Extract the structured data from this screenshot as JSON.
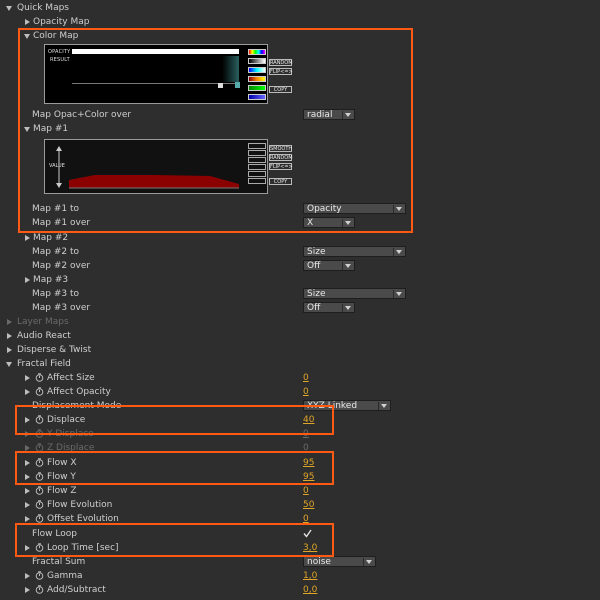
{
  "sections": {
    "quick_maps": "Quick Maps",
    "opacity_map": "Opacity Map",
    "color_map": "Color Map",
    "map1": "Map #1",
    "map2": "Map #2",
    "map3": "Map #3",
    "layer_maps": "Layer Maps",
    "audio_react": "Audio React",
    "disperse_twist": "Disperse & Twist",
    "fractal_field": "Fractal Field"
  },
  "color_map_widget": {
    "opacity_label": "OPACITY",
    "result_label": "RESULT",
    "btn_random": "RANDOM",
    "btn_flip": "FLIP<=>",
    "btn_copy": "COPY"
  },
  "map1_widget": {
    "value_label": "VALUE",
    "btn_smooth": "SMOOTH",
    "btn_random": "RANDOM",
    "btn_flip": "FLIP<=>",
    "btn_copy": "COPY"
  },
  "props": {
    "map_opac_color_over": {
      "label": "Map Opac+Color over",
      "value": "radial"
    },
    "map1_to": {
      "label": "Map #1 to",
      "value": "Opacity"
    },
    "map1_over": {
      "label": "Map #1 over",
      "value": "X"
    },
    "map2_to": {
      "label": "Map #2 to",
      "value": "Size"
    },
    "map2_over": {
      "label": "Map #2 over",
      "value": "Off"
    },
    "map3_to": {
      "label": "Map #3 to",
      "value": "Size"
    },
    "map3_over": {
      "label": "Map #3 over",
      "value": "Off"
    },
    "affect_size": {
      "label": "Affect Size",
      "value": "0"
    },
    "affect_opacity": {
      "label": "Affect Opacity",
      "value": "0"
    },
    "displacement_mode": {
      "label": "Displacement Mode",
      "value": "XYZ Linked"
    },
    "displace": {
      "label": "Displace",
      "value": "40"
    },
    "y_displace": {
      "label": "Y Displace",
      "value": "0"
    },
    "z_displace": {
      "label": "Z Displace",
      "value": "0"
    },
    "flow_x": {
      "label": "Flow X",
      "value": "95"
    },
    "flow_y": {
      "label": "Flow Y",
      "value": "95"
    },
    "flow_z": {
      "label": "Flow Z",
      "value": "0"
    },
    "flow_evolution": {
      "label": "Flow Evolution",
      "value": "50"
    },
    "offset_evolution": {
      "label": "Offset Evolution",
      "value": "0"
    },
    "flow_loop": {
      "label": "Flow Loop",
      "checked": true
    },
    "loop_time": {
      "label": "Loop Time [sec]",
      "value": "3,0"
    },
    "fractal_sum": {
      "label": "Fractal Sum",
      "value": "noise"
    },
    "gamma": {
      "label": "Gamma",
      "value": "1,0"
    },
    "add_subtract": {
      "label": "Add/Subtract",
      "value": "0,0"
    }
  },
  "colors": {
    "highlight": "#ff5a14",
    "value": "#e0a526",
    "map_fill": "#8b0000"
  }
}
